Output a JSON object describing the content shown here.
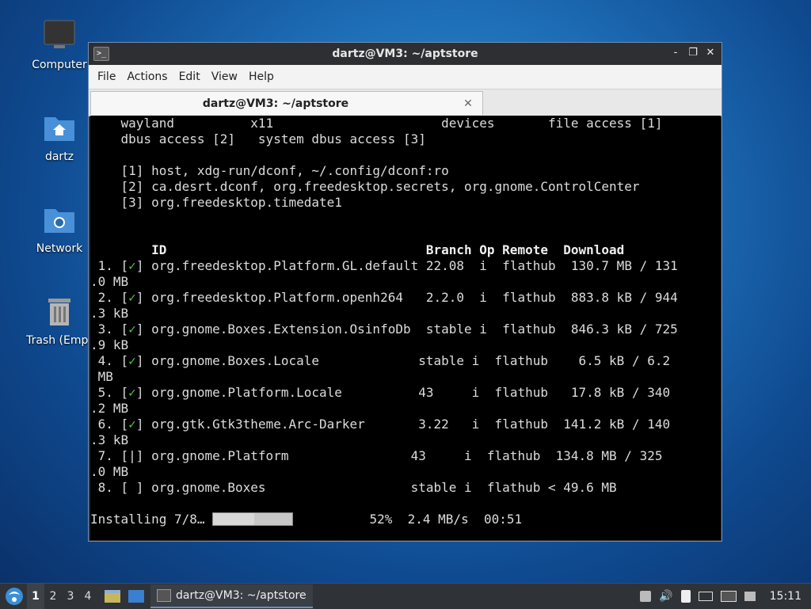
{
  "desktop": {
    "icons": [
      {
        "label": "Computer"
      },
      {
        "label": "dartz"
      },
      {
        "label": "Network"
      },
      {
        "label": "Trash (Empt"
      }
    ]
  },
  "window": {
    "title": "dartz@VM3: ~/aptstore",
    "controls": [
      "-",
      "❐",
      "✕"
    ],
    "menu": [
      "File",
      "Edit",
      "View",
      "Help",
      "Actions"
    ],
    "tab": {
      "label": "dartz@VM3: ~/aptstore",
      "close": "✕"
    }
  },
  "terminal": {
    "lines": [
      "    wayland          x11                      devices       file access [1]",
      "    dbus access [2]   system dbus access [3]",
      "",
      "    [1] host, xdg-run/dconf, ~/.config/dconf:ro",
      "    [2] ca.desrt.dconf, org.freedesktop.secrets, org.gnome.ControlCenter",
      "    [3] org.freedesktop.timedate1",
      "",
      "",
      "",
      "",
      " 1. [",
      ".0 MB",
      " 2. [",
      ".3 kB",
      " 3. [",
      ".9 kB",
      " 4. [",
      " MB",
      " 5. [",
      ".2 MB",
      " 6. [",
      ".3 kB",
      " 7. [|] org.gnome.Platform                43     i  flathub  134.8 MB / 325",
      ".0 MB",
      " 8. [ ] org.gnome.Boxes                   stable i  flathub < 49.6 MB"
    ],
    "header": "        ID                                  Branch Op Remote  Download",
    "rows": [
      {
        "prefix": " 1. [",
        "mark": "✓",
        "rest": "] org.freedesktop.Platform.GL.default 22.08  i  flathub  130.7 MB / 131"
      },
      {
        "prefix": " 2. [",
        "mark": "✓",
        "rest": "] org.freedesktop.Platform.openh264   2.2.0  i  flathub  883.8 kB / 944"
      },
      {
        "prefix": " 3. [",
        "mark": "✓",
        "rest": "] org.gnome.Boxes.Extension.OsinfoDb  stable i  flathub  846.3 kB / 725"
      },
      {
        "prefix": " 4. [",
        "mark": "✓",
        "rest": "] org.gnome.Boxes.Locale             stable i  flathub    6.5 kB / 6.2"
      },
      {
        "prefix": " 5. [",
        "mark": "✓",
        "rest": "] org.gnome.Platform.Locale          43     i  flathub   17.8 kB / 340"
      },
      {
        "prefix": " 6. [",
        "mark": "✓",
        "rest": "] org.gtk.Gtk3theme.Arc-Darker       3.22   i  flathub  141.2 kB / 140"
      }
    ],
    "status": {
      "prefix": "Installing 7/8…",
      "progress": 0.52,
      "suffix": "          52%  2.4 MB/s  00:51"
    }
  },
  "taskbar": {
    "workspaces": [
      "1",
      "2",
      "3",
      "4"
    ],
    "active_task": "dartz@VM3: ~/aptstore",
    "clock": "15:11",
    "colors": {
      "accent": "#6f8fb7",
      "check": "#4ec94e"
    }
  }
}
